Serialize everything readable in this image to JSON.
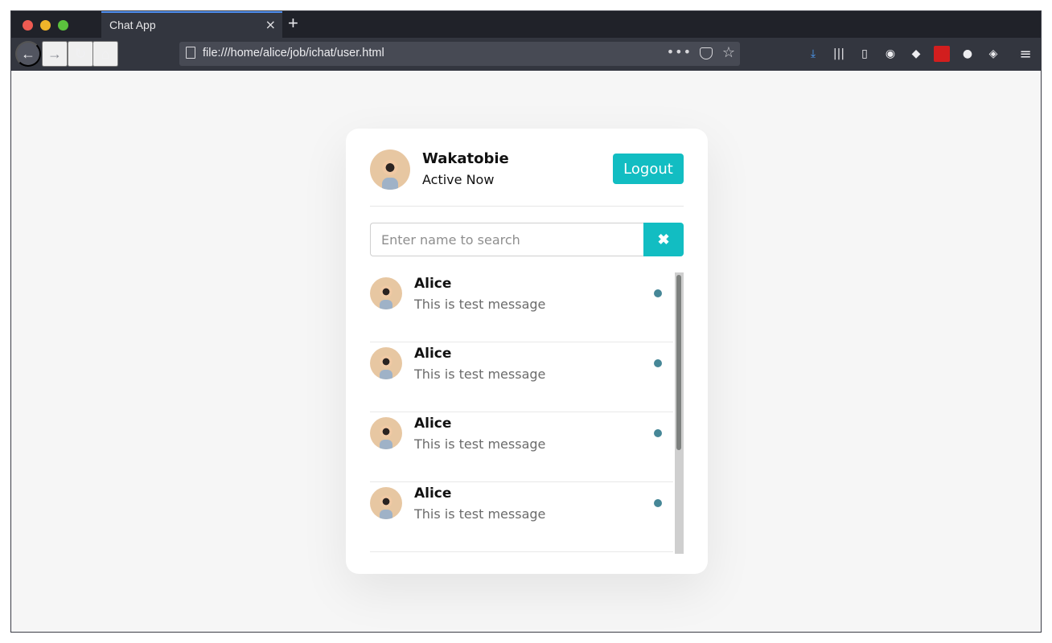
{
  "browser": {
    "tab_title": "Chat App",
    "tab_close_icon": "×",
    "new_tab_icon": "+",
    "url": "file:///home/alice/job/ichat/user.html",
    "page_actions_icon": "•••",
    "star_icon": "☆",
    "back_icon": "←",
    "forward_icon": "→",
    "reload_icon": "↻",
    "home_icon": "⌂"
  },
  "header": {
    "user_name": "Wakatobie",
    "status": "Active Now",
    "logout_label": "Logout"
  },
  "search": {
    "placeholder": "Enter name to search",
    "button_icon": "✖"
  },
  "users": [
    {
      "name": "Alice",
      "message": "This is test message"
    },
    {
      "name": "Alice",
      "message": "This is test message"
    },
    {
      "name": "Alice",
      "message": "This is test message"
    },
    {
      "name": "Alice",
      "message": "This is test message"
    }
  ],
  "colors": {
    "accent": "#12bdc2",
    "online_dot": "#468797",
    "browser_chrome": "#33363f"
  }
}
